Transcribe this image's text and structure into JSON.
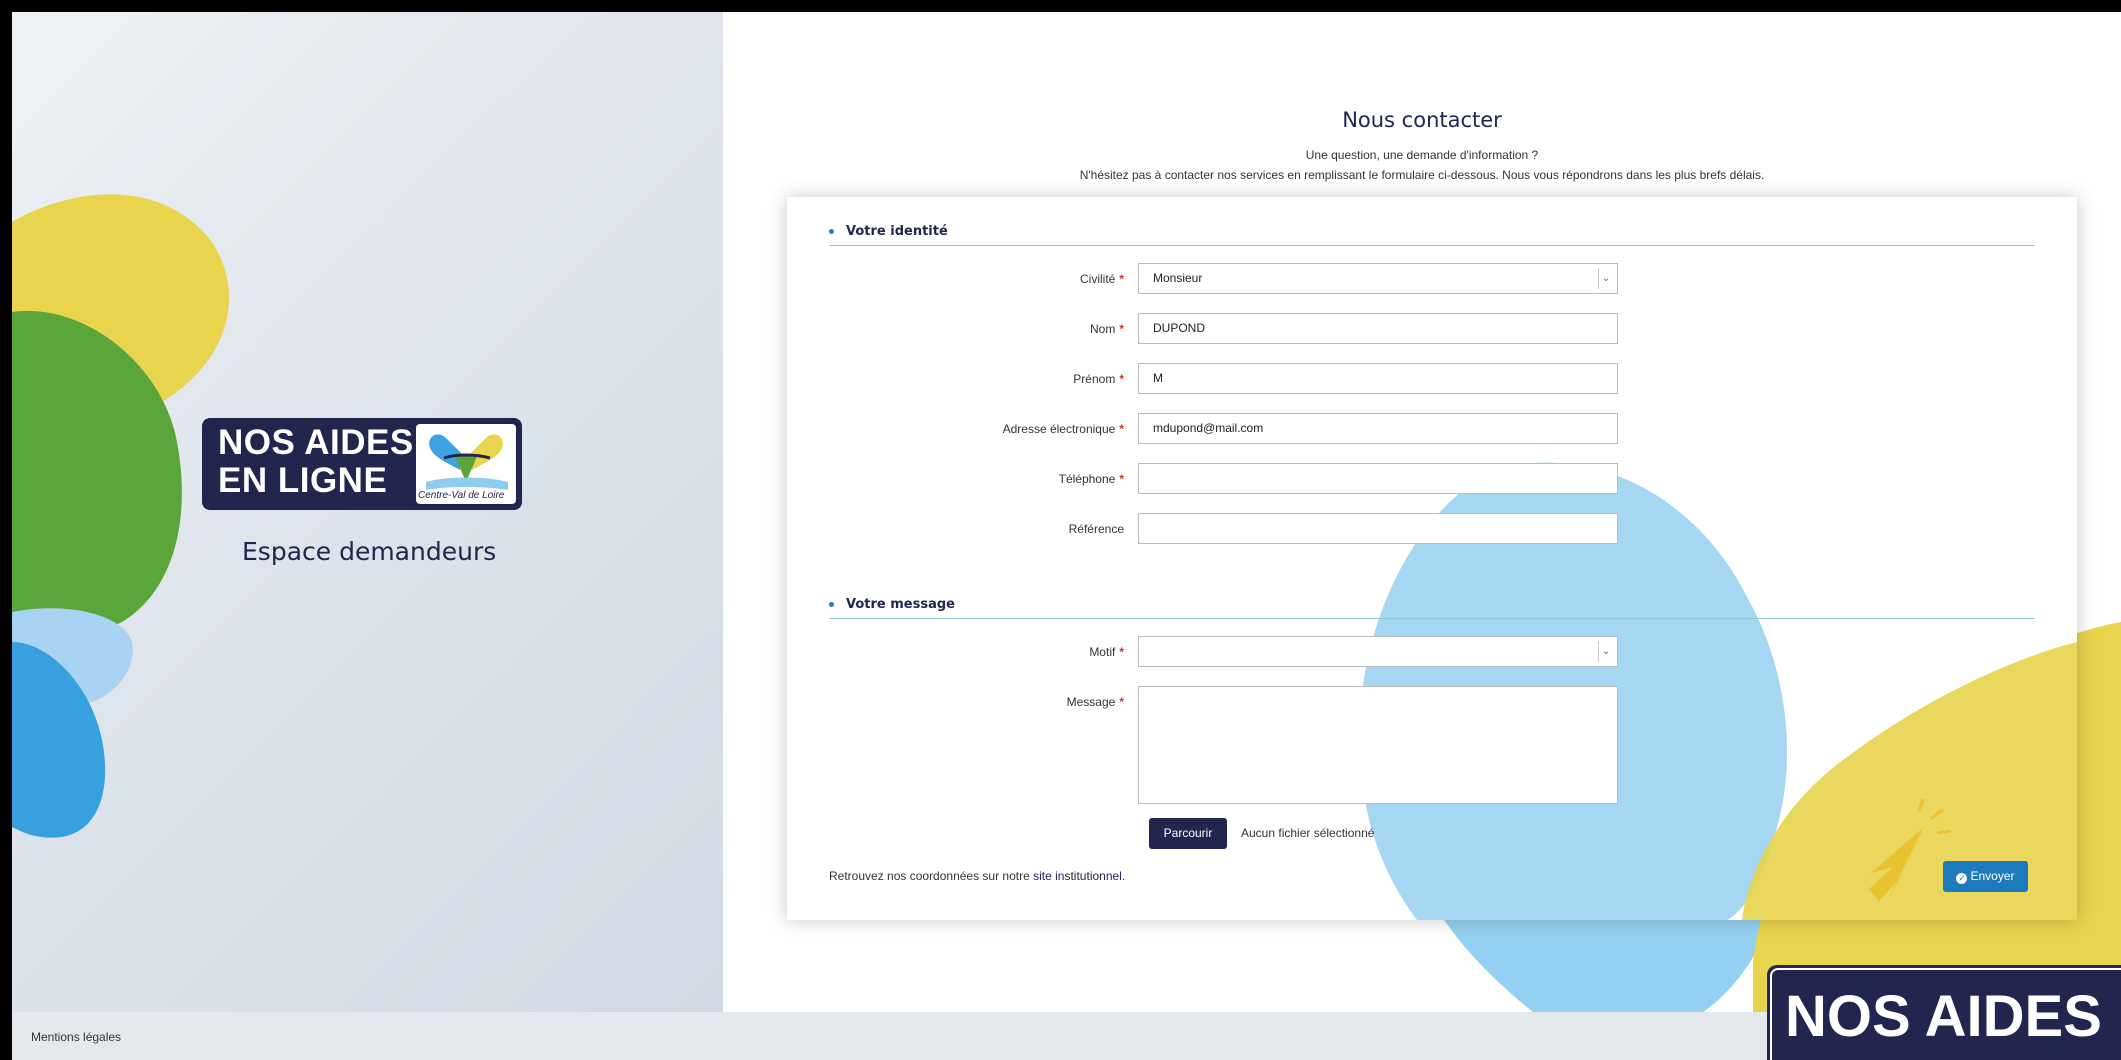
{
  "brand": {
    "logo_line1": "NOS AIDES",
    "logo_line2": "EN LIGNE",
    "region": "Centre-Val de Loire",
    "space_label": "Espace demandeurs",
    "badge_text": "NOS AIDES"
  },
  "page": {
    "title": "Nous contacter",
    "intro_line1": "Une question, une demande d'information ?",
    "intro_line2": "N'hésitez pas à contacter nos services en remplissant le formulaire ci-dessous. Nous vous répondrons dans les plus brefs délais."
  },
  "identity_section": {
    "title": "Votre identité",
    "fields": {
      "civilite": {
        "label": "Civilité",
        "value": "Monsieur"
      },
      "nom": {
        "label": "Nom",
        "value": "DUPOND"
      },
      "prenom": {
        "label": "Prénom",
        "value": "M"
      },
      "email": {
        "label": "Adresse électronique",
        "value": "mdupond@mail.com"
      },
      "telephone": {
        "label": "Téléphone",
        "value": ""
      },
      "reference": {
        "label": "Référence",
        "value": ""
      }
    }
  },
  "message_section": {
    "title": "Votre message",
    "fields": {
      "motif": {
        "label": "Motif",
        "value": ""
      },
      "message": {
        "label": "Message",
        "value": ""
      }
    },
    "browse_label": "Parcourir",
    "no_file_label": "Aucun fichier sélectionné"
  },
  "footer_text": {
    "coord_prefix": "Retrouvez nos coordonnées sur notre ",
    "coord_link": "site institutionnel",
    "coord_suffix": ".",
    "send_label": "Envoyer",
    "mentions": "Mentions légales"
  },
  "required_mark": "*",
  "colors": {
    "navy": "#22264f",
    "primary_blue": "#1d7bbd",
    "required_red": "#c0392b",
    "yellow": "#e8d44d",
    "green": "#5aa63a",
    "light_blue": "#8ecdf0"
  },
  "icons": {
    "select_arrow": "chevron-down-icon",
    "send_check": "check-circle-icon",
    "cursor": "pointer-hand-icon"
  }
}
